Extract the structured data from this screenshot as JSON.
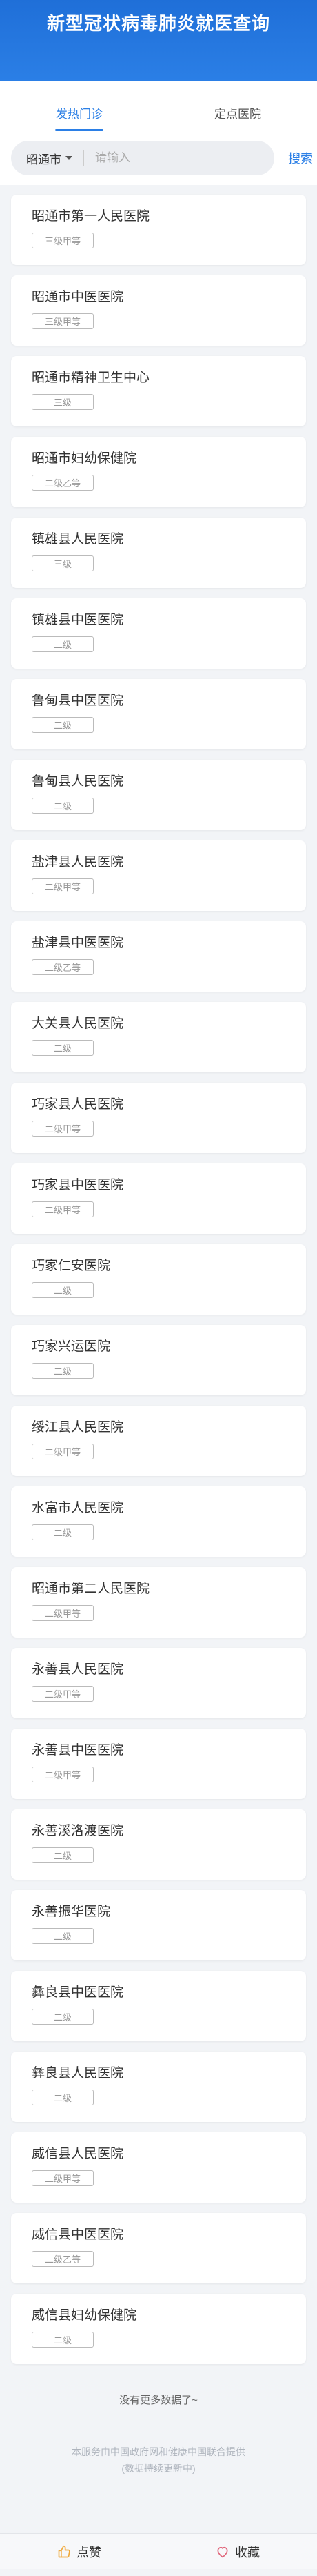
{
  "header": {
    "title": "新型冠状病毒肺炎就医查询"
  },
  "tabs": [
    {
      "label": "发热门诊"
    },
    {
      "label": "定点医院"
    }
  ],
  "search": {
    "city": "昭通市",
    "placeholder": "请输入",
    "button": "搜索"
  },
  "hospitals": [
    {
      "name": "昭通市第一人民医院",
      "level": "三级甲等"
    },
    {
      "name": "昭通市中医医院",
      "level": "三级甲等"
    },
    {
      "name": "昭通市精神卫生中心",
      "level": "三级"
    },
    {
      "name": "昭通市妇幼保健院",
      "level": "二级乙等"
    },
    {
      "name": "镇雄县人民医院",
      "level": "三级"
    },
    {
      "name": "镇雄县中医医院",
      "level": "二级"
    },
    {
      "name": "鲁甸县中医医院",
      "level": "二级"
    },
    {
      "name": "鲁甸县人民医院",
      "level": "二级"
    },
    {
      "name": "盐津县人民医院",
      "level": "二级甲等"
    },
    {
      "name": "盐津县中医医院",
      "level": "二级乙等"
    },
    {
      "name": "大关县人民医院",
      "level": "二级"
    },
    {
      "name": "巧家县人民医院",
      "level": "二级甲等"
    },
    {
      "name": "巧家县中医医院",
      "level": "二级甲等"
    },
    {
      "name": "巧家仁安医院",
      "level": "二级"
    },
    {
      "name": "巧家兴运医院",
      "level": "二级"
    },
    {
      "name": "绥江县人民医院",
      "level": "二级甲等"
    },
    {
      "name": "水富市人民医院",
      "level": "二级"
    },
    {
      "name": "昭通市第二人民医院",
      "level": "二级甲等"
    },
    {
      "name": "永善县人民医院",
      "level": "二级甲等"
    },
    {
      "name": "永善县中医医院",
      "level": "二级甲等"
    },
    {
      "name": "永善溪洛渡医院",
      "level": "二级"
    },
    {
      "name": "永善振华医院",
      "level": "二级"
    },
    {
      "name": "彝良县中医医院",
      "level": "二级"
    },
    {
      "name": "彝良县人民医院",
      "level": "二级"
    },
    {
      "name": "威信县人民医院",
      "level": "二级甲等"
    },
    {
      "name": "威信县中医医院",
      "level": "二级乙等"
    },
    {
      "name": "威信县妇幼保健院",
      "level": "二级"
    }
  ],
  "no_more": "没有更多数据了~",
  "disclaimer": {
    "line1": "本服务由中国政府网和健康中国联合提供",
    "line2": "(数据持续更新中)"
  },
  "footer": {
    "like": "点赞",
    "favorite": "收藏"
  },
  "colors": {
    "brand": "#2b7fe6",
    "like_icon": "#f0a93b",
    "favorite_icon": "#e0657a"
  }
}
